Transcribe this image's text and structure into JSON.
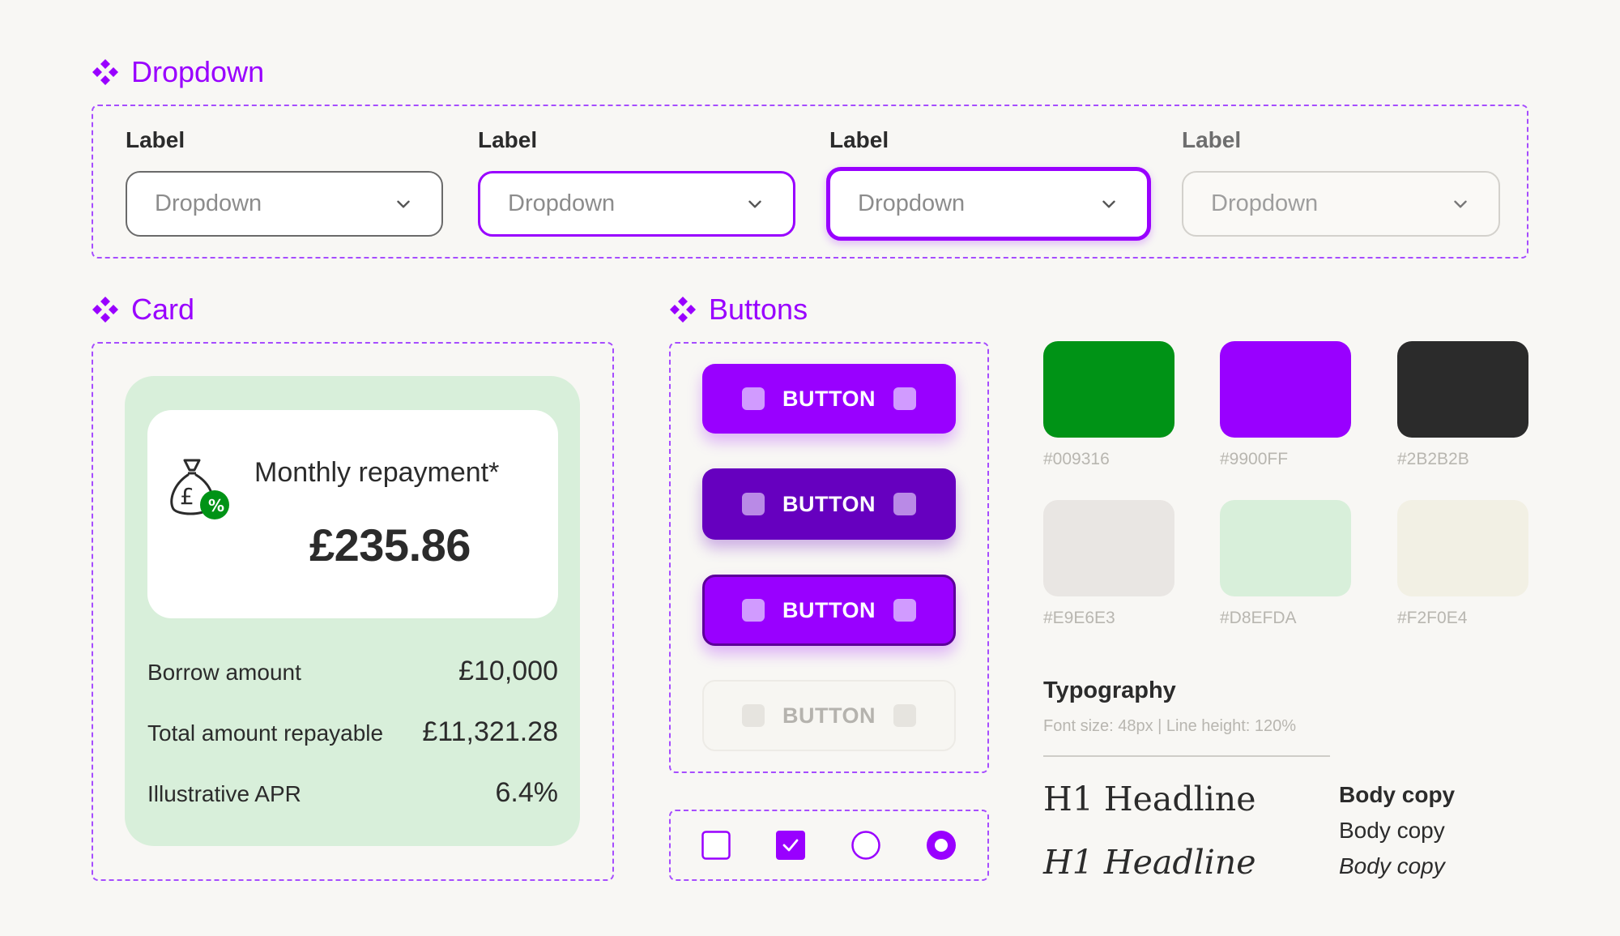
{
  "sections": {
    "dropdown": "Dropdown",
    "card": "Card",
    "buttons": "Buttons"
  },
  "dropdowns": [
    {
      "label": "Label",
      "placeholder": "Dropdown",
      "state": "default"
    },
    {
      "label": "Label",
      "placeholder": "Dropdown",
      "state": "hover"
    },
    {
      "label": "Label",
      "placeholder": "Dropdown",
      "state": "focus"
    },
    {
      "label": "Label",
      "placeholder": "Dropdown",
      "state": "disabled"
    }
  ],
  "card": {
    "title": "Monthly repayment*",
    "amount": "£235.86",
    "icon": "money-bag-percent-icon",
    "rows": [
      {
        "label": "Borrow amount",
        "value": "£10,000"
      },
      {
        "label": "Total amount repayable",
        "value": "£11,321.28"
      },
      {
        "label": "Illustrative APR",
        "value": "6.4%"
      }
    ]
  },
  "buttons": [
    {
      "label": "BUTTON",
      "state": "primary"
    },
    {
      "label": "BUTTON",
      "state": "pressed"
    },
    {
      "label": "BUTTON",
      "state": "focused"
    },
    {
      "label": "BUTTON",
      "state": "disabled"
    }
  ],
  "controls": [
    {
      "type": "checkbox",
      "checked": false
    },
    {
      "type": "checkbox",
      "checked": true
    },
    {
      "type": "radio",
      "checked": false
    },
    {
      "type": "radio",
      "checked": true
    }
  ],
  "colors": [
    {
      "hex": "#009316",
      "label": "#009316"
    },
    {
      "hex": "#9900FF",
      "label": "#9900FF"
    },
    {
      "hex": "#2B2B2B",
      "label": "#2B2B2B"
    },
    {
      "hex": "#E9E6E3",
      "label": "#E9E6E3"
    },
    {
      "hex": "#D8EFDA",
      "label": "#D8EFDA"
    },
    {
      "hex": "#F2F0E4",
      "label": "#F2F0E4"
    }
  ],
  "typography": {
    "title": "Typography",
    "subtitle": "Font size: 48px | Line height: 120%",
    "h1": "H1 Headline",
    "h1_italic": "H1 Headline",
    "body_bold": "Body copy",
    "body_regular": "Body copy",
    "body_italic": "Body copy"
  }
}
